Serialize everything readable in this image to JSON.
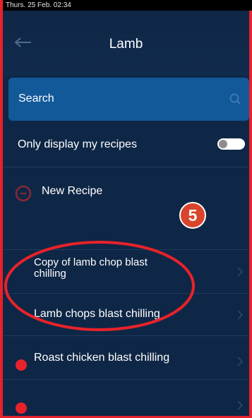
{
  "status_bar": {
    "datetime": "Thurs. 25 Feb. 02:34"
  },
  "header": {
    "title": "Lamb",
    "back_icon": "arrow-left-icon"
  },
  "search": {
    "placeholder": "Search",
    "icon": "search-icon"
  },
  "filter": {
    "label": "Only display my recipes",
    "toggle_on": false
  },
  "new_recipe": {
    "label": "New Recipe",
    "icon": "add-icon"
  },
  "annotation": {
    "step_number": "5",
    "color": "#d9452b"
  },
  "recipes": [
    {
      "label_line1": "Copy of lamb chop blast",
      "label_line2": "chilling"
    },
    {
      "label": "Lamb chops blast chilling"
    },
    {
      "label": "Roast chicken blast chilling"
    },
    {
      "label": ""
    }
  ],
  "colors": {
    "background": "#0f2746",
    "search_bg": "#12599a",
    "accent_red": "#e8222a"
  }
}
